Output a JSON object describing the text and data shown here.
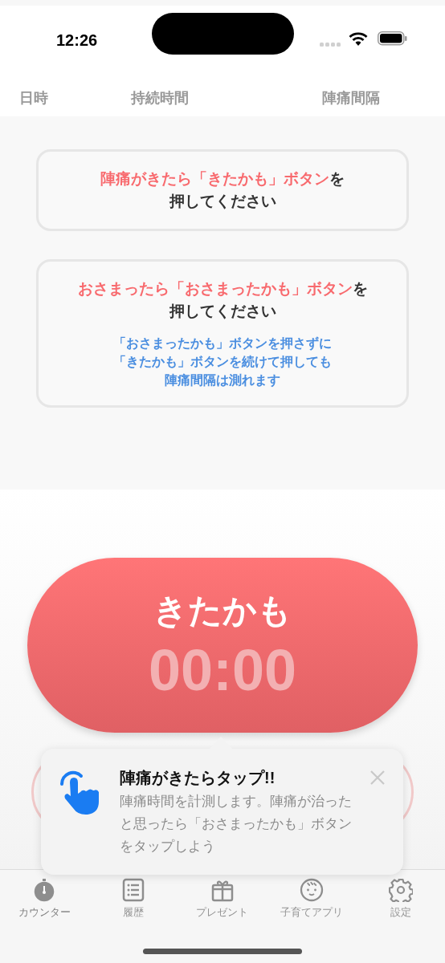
{
  "status_bar": {
    "time": "12:26"
  },
  "columns": [
    "日時",
    "持続時間",
    "陣痛間隔"
  ],
  "cards": [
    {
      "title_lines": [
        [
          {
            "kind": "highlight",
            "text": "陣痛がきたら「きたかも」ボタン"
          },
          {
            "kind": "plain",
            "text": "を"
          }
        ],
        [
          {
            "kind": "plain",
            "text": "押してください"
          }
        ]
      ]
    },
    {
      "title_lines": [
        [
          {
            "kind": "highlight",
            "text": "おさまったら「おさまったかも」ボタン"
          },
          {
            "kind": "plain",
            "text": "を"
          }
        ],
        [
          {
            "kind": "plain",
            "text": "押してください"
          }
        ]
      ],
      "note": [
        "「おさまったかも」ボタンを押さずに",
        "「きたかも」ボタンを続けて押しても",
        "陣痛間隔は測れます"
      ]
    }
  ],
  "main_button": {
    "label": "きたかも",
    "timer": "00:00"
  },
  "tooltip": {
    "title": "陣痛がきたらタップ!!",
    "body": "陣痛時間を計測します。陣痛が治ったと思ったら「おさまったかも」ボタンをタップしよう"
  },
  "tabs": [
    {
      "kind": "stopwatch",
      "label": "カウンター",
      "selected": true
    },
    {
      "kind": "list",
      "label": "履歴",
      "selected": false
    },
    {
      "kind": "gift",
      "label": "プレゼント",
      "selected": false
    },
    {
      "kind": "baby",
      "label": "子育てアプリ",
      "selected": false
    },
    {
      "kind": "gear",
      "label": "設定",
      "selected": false
    }
  ]
}
